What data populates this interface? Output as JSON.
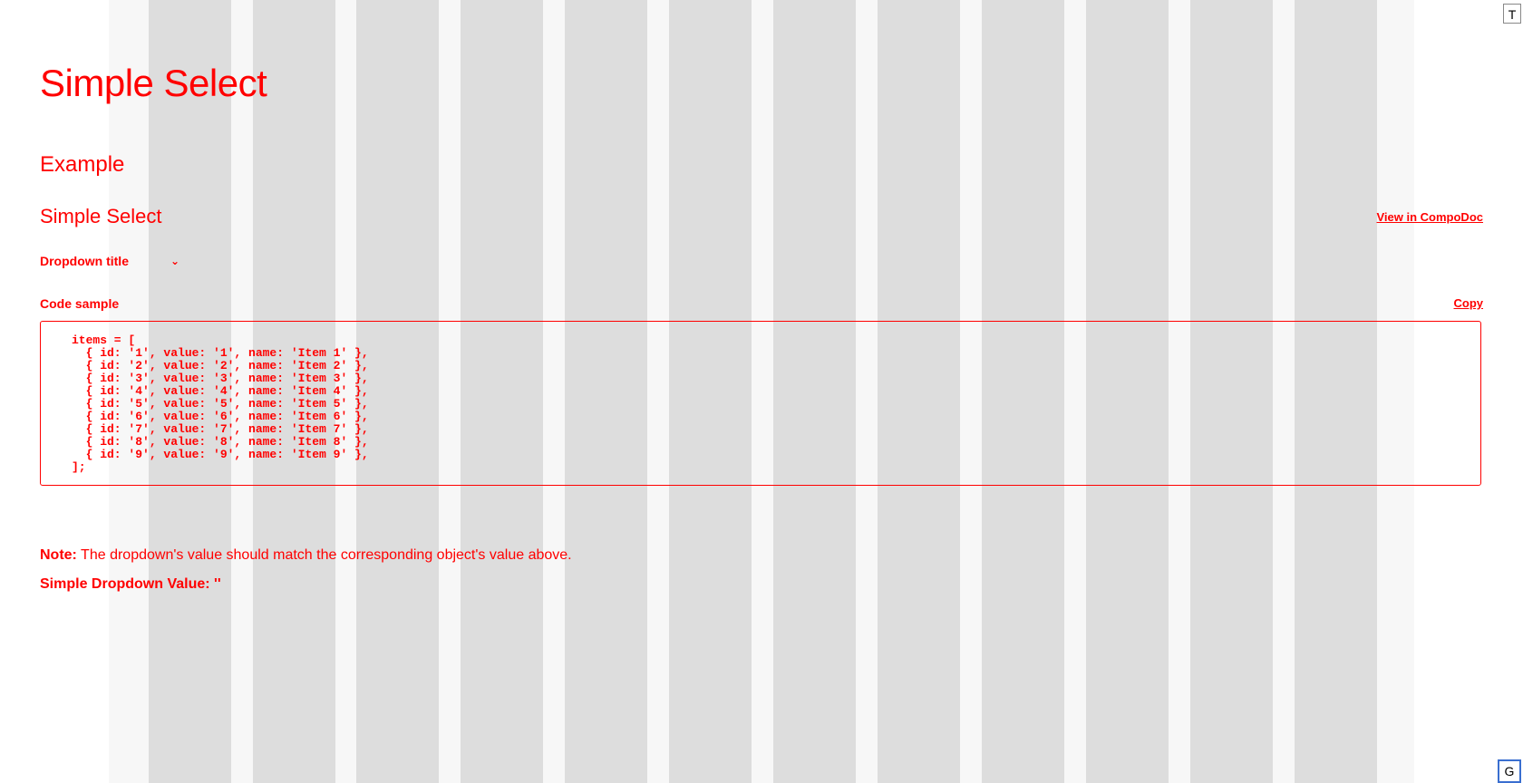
{
  "page": {
    "title": "Simple Select"
  },
  "example": {
    "heading": "Example",
    "demo_title": "Simple Select",
    "compodoc_link": "View in CompoDoc",
    "dropdown": {
      "label": "Dropdown title",
      "chevron": "⌄"
    },
    "code": {
      "label": "Code sample",
      "copy_label": "Copy",
      "lines": [
        "items = [",
        "  { id: '1', value: '1', name: 'Item 1' },",
        "  { id: '2', value: '2', name: 'Item 2' },",
        "  { id: '3', value: '3', name: 'Item 3' },",
        "  { id: '4', value: '4', name: 'Item 4' },",
        "  { id: '5', value: '5', name: 'Item 5' },",
        "  { id: '6', value: '6', name: 'Item 6' },",
        "  { id: '7', value: '7', name: 'Item 7' },",
        "  { id: '8', value: '8', name: 'Item 8' },",
        "  { id: '9', value: '9', name: 'Item 9' },",
        "];"
      ]
    },
    "note": {
      "label": "Note:",
      "text": " The dropdown's value should match the corresponding object's value above."
    },
    "value_line": {
      "label": "Simple Dropdown Value:",
      "value": " ''"
    }
  },
  "corner": {
    "top_label": "T",
    "bottom_label": "G"
  },
  "colors": {
    "text": "#ff0000",
    "grid_background": "#f7f7f7",
    "grid_column": "#dddddd"
  }
}
